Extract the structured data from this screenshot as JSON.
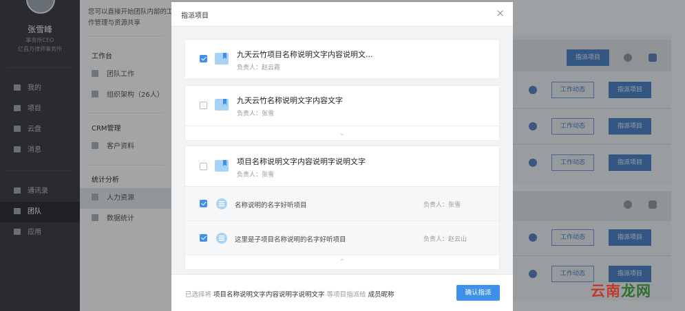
{
  "user": {
    "name": "张雪峰",
    "role": "事务所CEO",
    "firm": "亿昌万律师事务所"
  },
  "nav": [
    {
      "label": "我的",
      "icon": "person-icon"
    },
    {
      "label": "项目",
      "icon": "grid-icon"
    },
    {
      "label": "云盘",
      "icon": "cloud-icon"
    },
    {
      "label": "消息",
      "icon": "chat-icon"
    },
    {
      "label": "通讯录",
      "icon": "contacts-icon"
    },
    {
      "label": "团队",
      "icon": "flag-icon"
    },
    {
      "label": "应用",
      "icon": "apps-icon"
    }
  ],
  "sub": {
    "desc_1": "您可以直接开始团队内部的工",
    "desc_2": "作管理与资源共享",
    "workspace_title": "工作台",
    "team_work": "团队工作",
    "org": "组织架构（26人）",
    "crm_title": "CRM管理",
    "customers": "客户资料",
    "stats_title": "统计分析",
    "hr": "人力资源",
    "data_stats": "数据统计"
  },
  "background": {
    "assign_label": "指派项目",
    "activity_label": "工作动态"
  },
  "modal": {
    "title": "指派项目",
    "close": "×",
    "projects": [
      {
        "title": "九天云竹项目名称说明文字内容说明文...",
        "owner": "负责人：赵云霞",
        "checked": true
      },
      {
        "title": "九天云竹名称说明文字内容文字",
        "owner": "负责人：张雪",
        "checked": false
      },
      {
        "title": "项目名称说明文字内容说明字说明文字",
        "owner": "负责人：张雪",
        "checked": false
      }
    ],
    "subprojects": [
      {
        "name": "名称说明的名字好听项目",
        "owner": "负责人：张雪",
        "checked": true
      },
      {
        "name": "这里是子项目名称说明的名字好听项目",
        "owner": "负责人：赵云山",
        "checked": true
      }
    ],
    "footer": {
      "prefix": "已选择将",
      "project": "项目名称说明文字内容说明字说明文字",
      "middle": "等项目指派给",
      "member": "成员昵称",
      "confirm": "确认指派"
    }
  },
  "watermark": {
    "part1": "云南",
    "part2": "龙网"
  }
}
